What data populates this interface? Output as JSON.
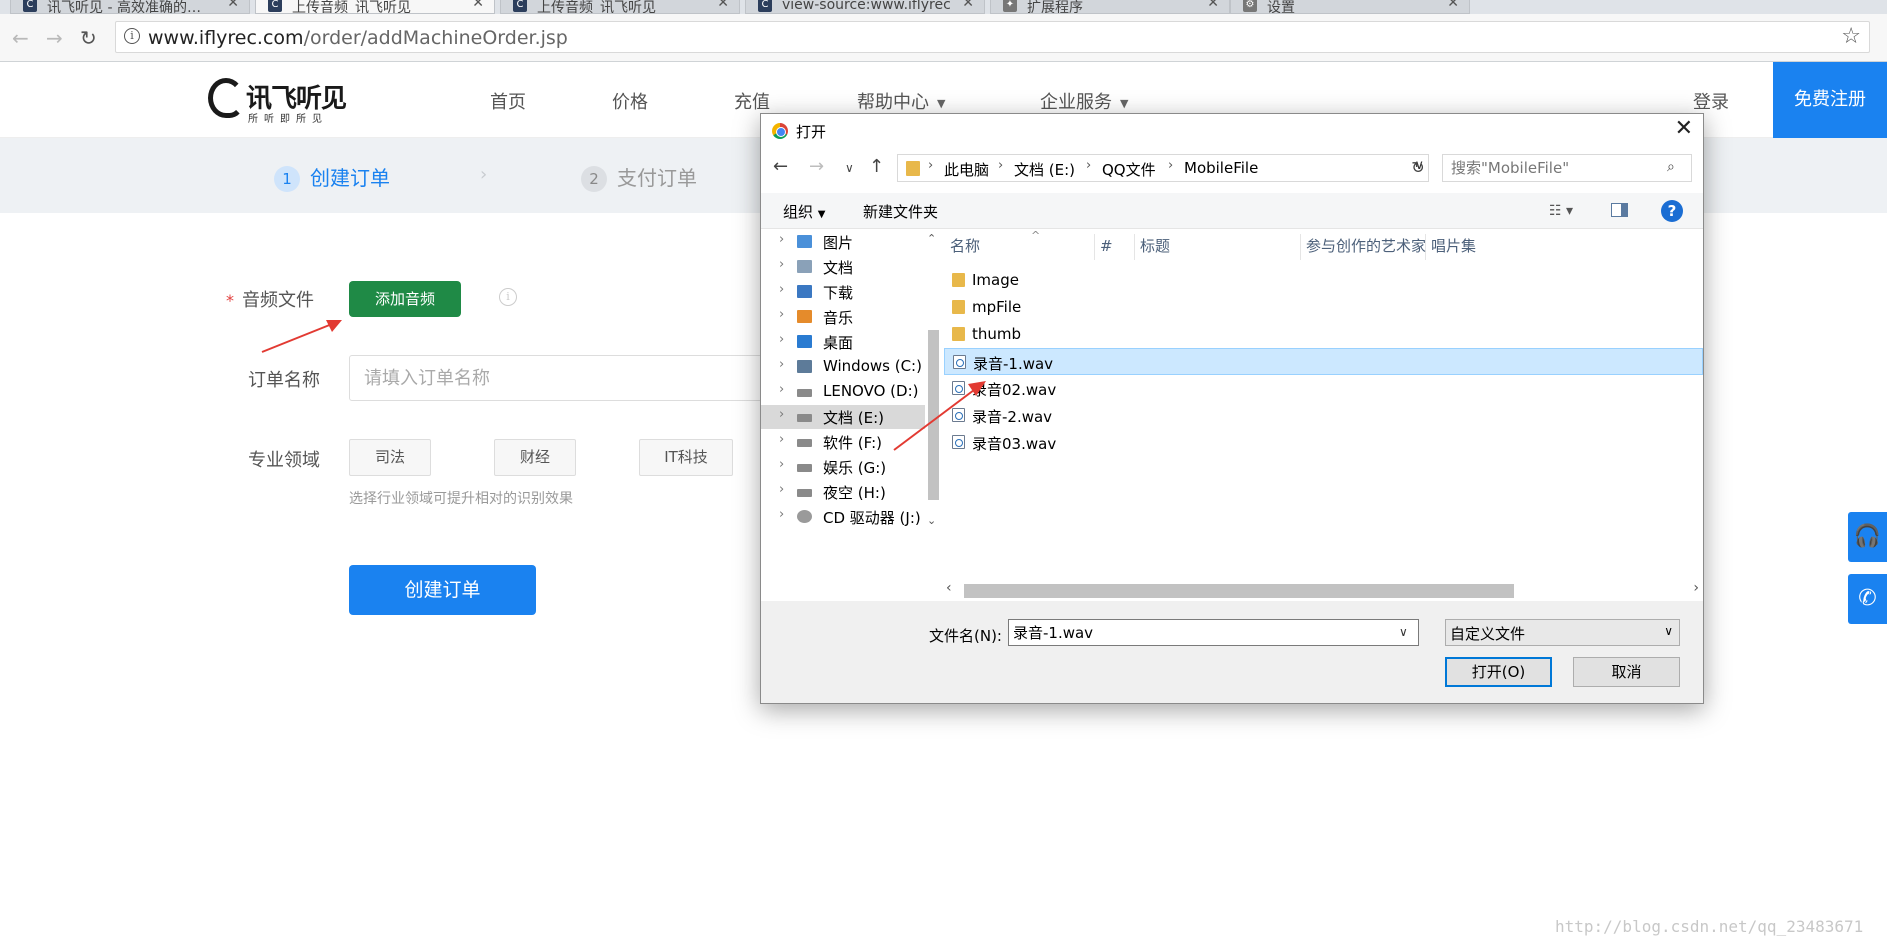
{
  "browser": {
    "tabs": [
      {
        "title": "讯飞听见 - 高效准确的…"
      },
      {
        "title": "上传音频_讯飞听见"
      },
      {
        "title": "上传音频_讯飞听见"
      },
      {
        "title": "view-source:www.iflyrec"
      },
      {
        "title": "扩展程序"
      },
      {
        "title": "设置"
      }
    ],
    "url_host": "www.iflyrec.com",
    "url_path": "/order/addMachineOrder.jsp"
  },
  "site": {
    "logo_name": "讯飞听见",
    "logo_slogan": "所听即所见",
    "nav": [
      "首页",
      "价格",
      "充值",
      "帮助中心",
      "企业服务"
    ],
    "login": "登录",
    "register": "免费注册"
  },
  "steps": [
    {
      "num": "1",
      "label": "创建订单"
    },
    {
      "num": "2",
      "label": "支付订单"
    }
  ],
  "form": {
    "audio_label": "音频文件",
    "add_audio": "添加音频",
    "order_name_label": "订单名称",
    "order_name_placeholder": "请填入订单名称",
    "domain_label": "专业领域",
    "domains": [
      "司法",
      "财经",
      "IT科技"
    ],
    "domain_hint": "选择行业领域可提升相对的识别效果",
    "create_order": "创建订单"
  },
  "watermark": "http://blog.csdn.net/qq_23483671",
  "dialog": {
    "title": "打开",
    "breadcrumb": [
      "此电脑",
      "文档 (E:)",
      "QQ文件",
      "MobileFile"
    ],
    "search_placeholder": "搜索\"MobileFile\"",
    "organize": "组织",
    "new_folder": "新建文件夹",
    "tree": [
      {
        "label": "图片",
        "icon": "pictures-icon",
        "color": "#4a90d9"
      },
      {
        "label": "文档",
        "icon": "documents-icon",
        "color": "#8aa1b8"
      },
      {
        "label": "下载",
        "icon": "downloads-icon",
        "color": "#3b78c2"
      },
      {
        "label": "音乐",
        "icon": "music-icon",
        "color": "#e58b2b"
      },
      {
        "label": "桌面",
        "icon": "desktop-icon",
        "color": "#2a7bd1"
      },
      {
        "label": "Windows (C:)",
        "icon": "windows-drive-icon",
        "color": "#5d7b99"
      },
      {
        "label": "LENOVO (D:)",
        "icon": "drive-icon",
        "color": "#8a8a8a"
      },
      {
        "label": "文档 (E:)",
        "icon": "drive-icon",
        "color": "#8a8a8a"
      },
      {
        "label": "软件 (F:)",
        "icon": "drive-icon",
        "color": "#8a8a8a"
      },
      {
        "label": "娱乐 (G:)",
        "icon": "drive-icon",
        "color": "#8a8a8a"
      },
      {
        "label": "夜空 (H:)",
        "icon": "drive-icon",
        "color": "#8a8a8a"
      },
      {
        "label": "CD 驱动器 (J:)",
        "icon": "cd-drive-icon",
        "color": "#9a9a9a"
      }
    ],
    "columns": [
      "名称",
      "#",
      "标题",
      "参与创作的艺术家",
      "唱片集"
    ],
    "files": [
      {
        "name": "Image",
        "type": "folder"
      },
      {
        "name": "mpFile",
        "type": "folder"
      },
      {
        "name": "thumb",
        "type": "folder"
      },
      {
        "name": "录音-1.wav",
        "type": "wav"
      },
      {
        "name": "录音02.wav",
        "type": "wav"
      },
      {
        "name": "录音-2.wav",
        "type": "wav"
      },
      {
        "name": "录音03.wav",
        "type": "wav"
      }
    ],
    "filename_label": "文件名(N):",
    "filename_value": "录音-1.wav",
    "filetype": "自定义文件",
    "open": "打开(O)",
    "cancel": "取消"
  }
}
